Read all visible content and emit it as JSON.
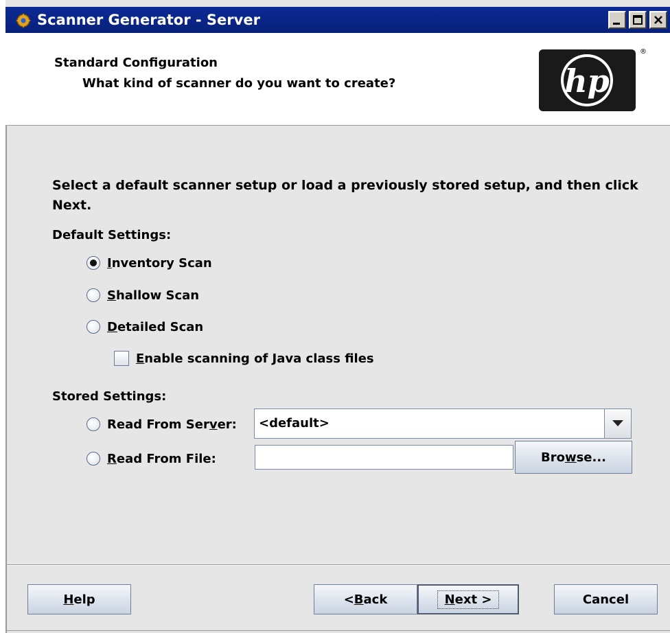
{
  "window": {
    "title": "Scanner Generator - Server"
  },
  "header": {
    "title": "Standard Configuration",
    "subtitle": "What kind of scanner do you want to create?",
    "logo_text": "hp",
    "logo_mark": "®"
  },
  "instructions": "Select a default scanner setup or load a previously stored setup, and then click Next.",
  "default_settings": {
    "label": "Default Settings:",
    "options": [
      {
        "label": "Inventory Scan",
        "mnemonic": "I",
        "rest": "nventory Scan",
        "selected": true
      },
      {
        "label": "Shallow Scan",
        "mnemonic": "S",
        "rest": "hallow Scan",
        "selected": false
      },
      {
        "label": "Detailed Scan",
        "mnemonic": "D",
        "rest": "etailed Scan",
        "selected": false
      }
    ],
    "java_checkbox": {
      "label": "Enable scanning of Java class files",
      "mnemonic": "E",
      "rest": "nable scanning of Java class files",
      "checked": false
    }
  },
  "stored_settings": {
    "label": "Stored Settings:",
    "server": {
      "label_pre": "Read From Ser",
      "mnemonic": "v",
      "label_post": "er:",
      "value": "<default>",
      "selected": false
    },
    "file": {
      "mnemonic": "R",
      "label_post": "ead From File:",
      "value": "",
      "selected": false
    },
    "browse": {
      "pre": "Bro",
      "mnemonic": "w",
      "post": "se..."
    }
  },
  "footer": {
    "help": {
      "mnemonic": "H",
      "post": "elp"
    },
    "back": {
      "pre": "< ",
      "mnemonic": "B",
      "post": "ack"
    },
    "next": {
      "mnemonic": "N",
      "post": "ext >"
    },
    "cancel": "Cancel"
  }
}
